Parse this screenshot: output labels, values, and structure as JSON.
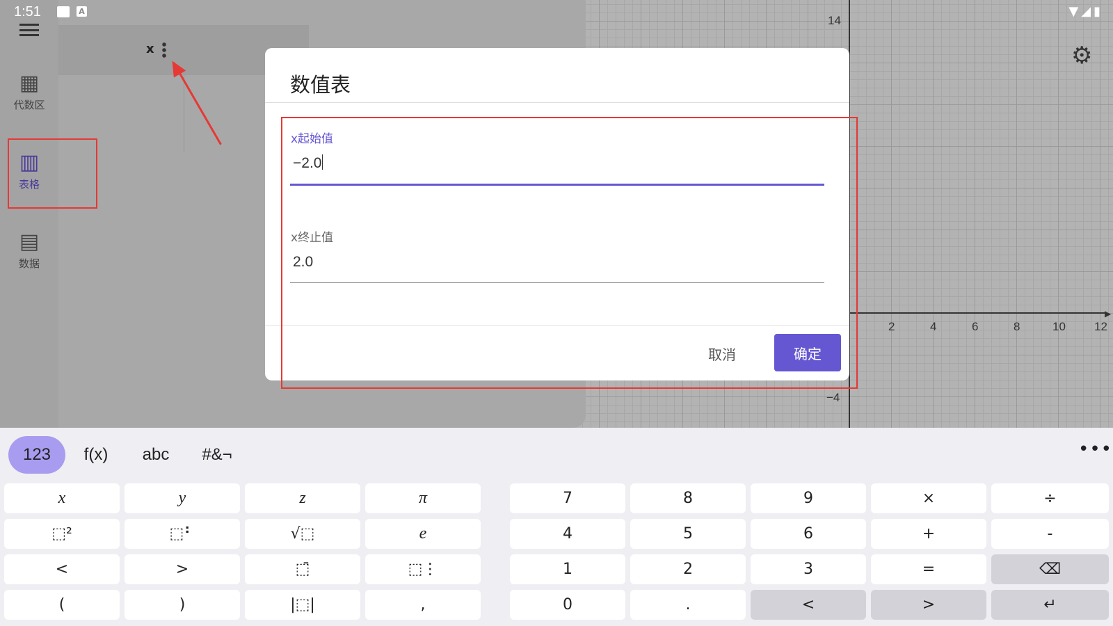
{
  "status_bar": {
    "time": "1:51",
    "notif_letter": "A"
  },
  "rail": {
    "items": [
      {
        "label": "代数区",
        "icon": "calculator-icon"
      },
      {
        "label": "表格",
        "icon": "table-icon"
      },
      {
        "label": "数据",
        "icon": "grid-data-icon"
      }
    ]
  },
  "table": {
    "header_var": "x"
  },
  "graph": {
    "x_ticks": [
      "2",
      "4",
      "6",
      "8",
      "10",
      "12"
    ],
    "y_ticks": [
      "14",
      "−4"
    ]
  },
  "dialog": {
    "title": "数值表",
    "start_label": "x起始值",
    "start_value": "−2.0",
    "end_label": "x终止值",
    "end_value": "2.0",
    "cancel_label": "取消",
    "ok_label": "确定"
  },
  "keyboard": {
    "tabs": [
      "123",
      "f(x)",
      "abc",
      "#&¬"
    ],
    "more": "•••",
    "left_keys": [
      [
        "x",
        "y",
        "z",
        "π"
      ],
      [
        "⬚²",
        "⬚⠃",
        "√⬚",
        "e"
      ],
      [
        "<",
        ">",
        "⬚̄",
        "⬚⋮"
      ],
      [
        "(",
        ")",
        "|⬚|",
        ","
      ]
    ],
    "right_keys": [
      [
        "7",
        "8",
        "9",
        "×",
        "÷"
      ],
      [
        "4",
        "5",
        "6",
        "+",
        "-"
      ],
      [
        "1",
        "2",
        "3",
        "=",
        "⌫"
      ],
      [
        "0",
        ".",
        "<",
        ">",
        "↵"
      ]
    ]
  },
  "colors": {
    "accent": "#6557d2",
    "annotation": "#e53935"
  }
}
